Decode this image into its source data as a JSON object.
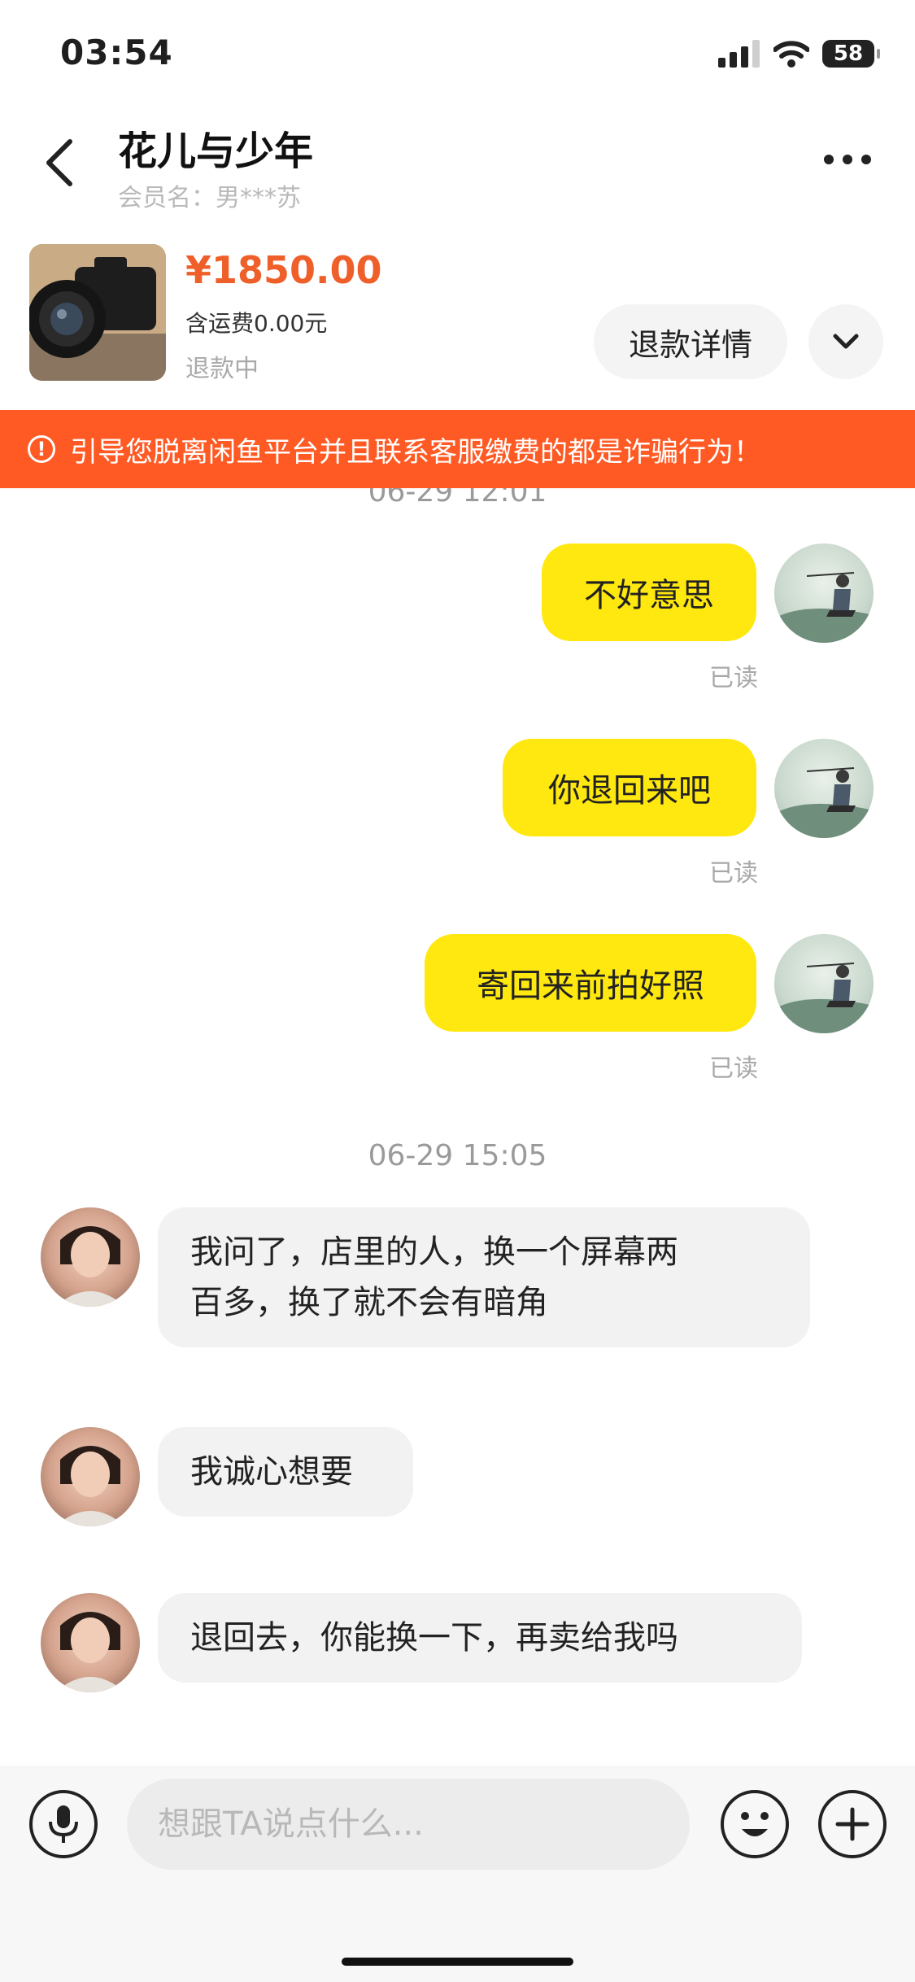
{
  "status_bar": {
    "time": "03:54",
    "battery": "58"
  },
  "header": {
    "title": "花儿与少年",
    "member_label": "会员名：",
    "member_name": "男***苏"
  },
  "product": {
    "price": "¥1850.00",
    "shipping": "含运费0.00元",
    "status": "退款中",
    "refund_button": "退款详情"
  },
  "warning": {
    "icon": "!",
    "text": "引导您脱离闲鱼平台并且联系客服缴费的都是诈骗行为！"
  },
  "timestamps": [
    "06-29 12:01",
    "06-29 15:05"
  ],
  "outgoing": [
    {
      "text": "不好意思",
      "read": "已读"
    },
    {
      "text": "你退回来吧",
      "read": "已读"
    },
    {
      "text": "寄回来前拍好照",
      "read": "已读"
    }
  ],
  "incoming": [
    {
      "line1": "我问了，店里的人，换一个屏幕两",
      "line2": "百多，换了就不会有暗角"
    },
    {
      "line1": "我诚心想要"
    },
    {
      "line1": "退回去，你能换一下，再卖给我吗"
    }
  ],
  "input": {
    "placeholder": "想跟TA说点什么..."
  },
  "icons": {
    "back": "chevron-left-icon",
    "more": "more-dots-icon",
    "expand": "chevron-down-icon",
    "mic": "microphone-icon",
    "emoji": "smile-icon",
    "add": "plus-icon"
  },
  "colors": {
    "accent_yellow": "#ffe80f",
    "warning_orange": "#ff5a24",
    "price_orange": "#ef5f2a"
  }
}
